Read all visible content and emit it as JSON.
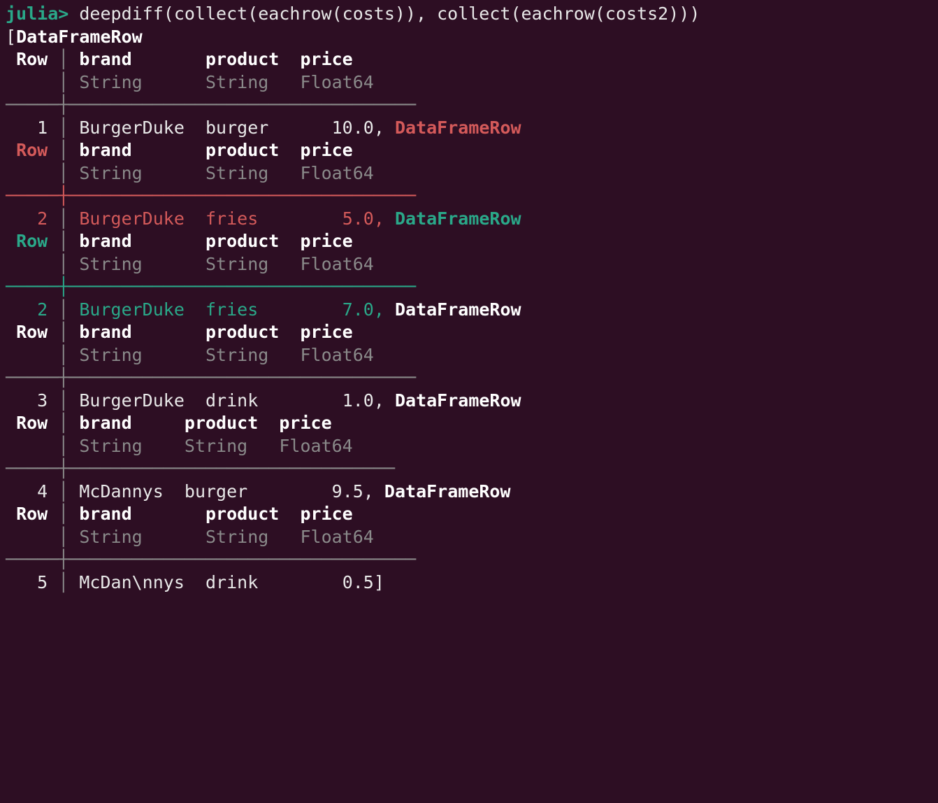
{
  "prompt": "julia>",
  "command": " deepdiff(collect(eachrow(costs)), collect(eachrow(costs2)))",
  "bracket_open": "[",
  "dfrow": "DataFrameRow",
  "comma": ",",
  "bracket_close": "]",
  "col": {
    "row": "Row",
    "brand": "brand",
    "product": "product",
    "price": "price",
    "string": "String",
    "float64": "Float64"
  },
  "rows": {
    "r1": {
      "num": "1",
      "brand": "BurgerDuke",
      "product": "burger",
      "price": "10.0"
    },
    "r2a": {
      "num": "2",
      "brand": "BurgerDuke",
      "product": "fries",
      "price": "5.0"
    },
    "r2b": {
      "num": "2",
      "brand": "BurgerDuke",
      "product": "fries",
      "price": "7.0"
    },
    "r3": {
      "num": "3",
      "brand": "BurgerDuke",
      "product": "drink",
      "price": "1.0"
    },
    "r4": {
      "num": "4",
      "brand": "McDannys",
      "product": "burger",
      "price": "9.5"
    },
    "r5": {
      "num": "5",
      "brand": "McDan\\nnys",
      "product": "drink",
      "price": "0.5"
    }
  }
}
